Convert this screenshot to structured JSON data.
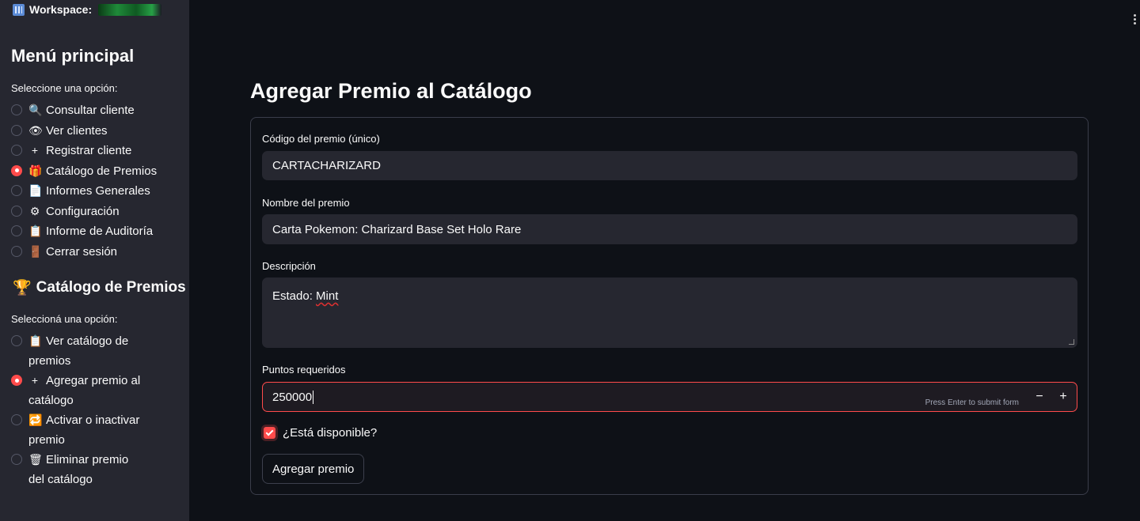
{
  "workspace": {
    "label": "Workspace:"
  },
  "sidebar": {
    "menu_title": "Menú principal",
    "menu_prompt": "Seleccione una opción:",
    "menu_items": [
      {
        "icon": "🔍",
        "icon_name": "magnifier-icon",
        "label": "Consultar cliente",
        "selected": false
      },
      {
        "icon": "👁",
        "icon_name": "eye-icon",
        "label": "Ver clientes",
        "selected": false
      },
      {
        "icon": "+",
        "icon_name": "plus-icon",
        "label": "Registrar cliente",
        "selected": false
      },
      {
        "icon": "🎁",
        "icon_name": "gift-icon",
        "label": "Catálogo de Premios",
        "selected": true
      },
      {
        "icon": "📄",
        "icon_name": "document-icon",
        "label": "Informes Generales",
        "selected": false
      },
      {
        "icon": "⚙",
        "icon_name": "gear-icon",
        "label": "Configuración",
        "selected": false
      },
      {
        "icon": "📋",
        "icon_name": "clipboard-icon",
        "label": "Informe de Auditoría",
        "selected": false
      },
      {
        "icon": "🚪",
        "icon_name": "door-icon",
        "label": "Cerrar sesión",
        "selected": false
      }
    ],
    "section_icon": "🏆",
    "section_title": "Catálogo de Premios",
    "section_prompt": "Seleccioná una opción:",
    "section_items": [
      {
        "icon": "📋",
        "icon_name": "clipboard-icon",
        "label": "Ver catálogo de premios",
        "selected": false
      },
      {
        "icon": "+",
        "icon_name": "plus-icon",
        "label": "Agregar premio al catálogo",
        "selected": true
      },
      {
        "icon": "🔁",
        "icon_name": "repeat-icon",
        "label": "Activar o inactivar premio",
        "selected": false
      },
      {
        "icon": "🗑",
        "icon_name": "trash-icon",
        "label": "Eliminar premio del catálogo",
        "selected": false
      }
    ]
  },
  "main": {
    "title": "Agregar Premio al Catálogo",
    "form": {
      "code_label": "Código del premio (único)",
      "code_value": "CARTACHARIZARD",
      "name_label": "Nombre del premio",
      "name_value": "Carta Pokemon: Charizard Base Set Holo Rare",
      "desc_label": "Descripción",
      "desc_prefix": "Estado: ",
      "desc_word": "Mint",
      "points_label": "Puntos requeridos",
      "points_value": "250000",
      "points_hint": "Press Enter to submit form",
      "minus": "−",
      "plus": "+",
      "available_label": "¿Está disponible?",
      "available_checked": true,
      "submit_label": "Agregar premio"
    }
  },
  "colors": {
    "accent": "#ff4b4b",
    "bg": "#0e1117",
    "sidebar": "#262730"
  }
}
